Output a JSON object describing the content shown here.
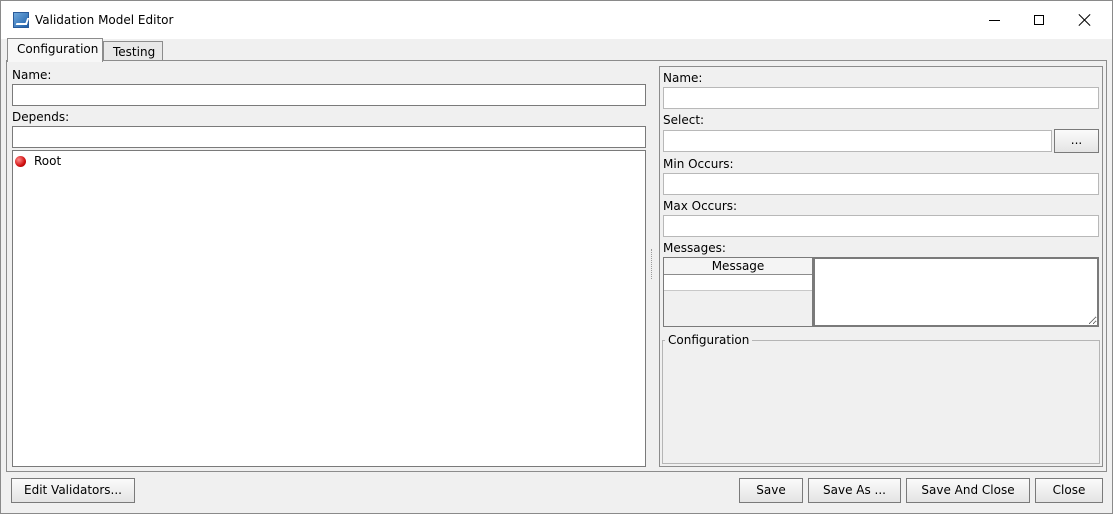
{
  "window": {
    "title": "Validation Model Editor",
    "icon": "app-icon",
    "controls": [
      "minimize-icon",
      "maximize-icon",
      "close-icon"
    ]
  },
  "tabs": [
    {
      "label": "Configuration",
      "active": true
    },
    {
      "label": "Testing",
      "active": false
    }
  ],
  "left": {
    "name_label": "Name:",
    "name_value": "",
    "depends_label": "Depends:",
    "depends_value": "",
    "tree": {
      "nodes": [
        {
          "label": "Root",
          "icon": "red-dot-icon"
        }
      ]
    }
  },
  "right": {
    "name_label": "Name:",
    "name_value": "",
    "select_label": "Select:",
    "select_value": "",
    "browse_label": "...",
    "min_occurs_label": "Min Occurs:",
    "min_occurs_value": "",
    "max_occurs_label": "Max Occurs:",
    "max_occurs_value": "",
    "messages_label": "Messages:",
    "messages_table": {
      "columns": [
        "Message"
      ],
      "rows": []
    },
    "configuration_group_label": "Configuration"
  },
  "footer": {
    "edit_validators": "Edit Validators...",
    "save": "Save",
    "save_as": "Save As ...",
    "save_and_close": "Save And Close",
    "close": "Close"
  }
}
